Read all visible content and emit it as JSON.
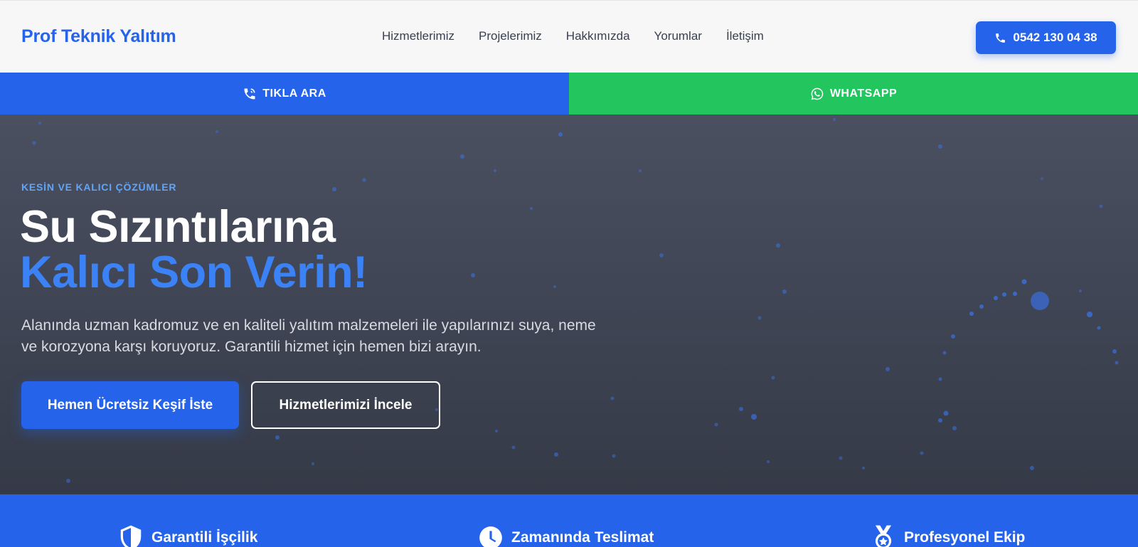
{
  "header": {
    "brand": "Prof Teknik Yalıtım",
    "nav": [
      "Hizmetlerimiz",
      "Projelerimiz",
      "Hakkımızda",
      "Yorumlar",
      "İletişim"
    ],
    "phone": "0542 130 04 38",
    "phone_icon": "phone-icon"
  },
  "callbar": {
    "call_label": "TIKLA ARA",
    "call_icon": "phone-call-icon",
    "whatsapp_label": "WHATSAPP",
    "whatsapp_icon": "whatsapp-icon"
  },
  "hero": {
    "eyebrow": "KESİN VE KALICI ÇÖZÜMLER",
    "title_line1": "Su Sızıntılarına",
    "title_line2": "Kalıcı Son Verin!",
    "lead": "Alanında uzman kadromuz ve en kaliteli yalıtım malzemeleri ile yapılarınızı suya, neme ve korozyona karşı koruyoruz. Garantili hizmet için hemen bizi arayın.",
    "primary_button": "Hemen Ücretsiz Keşif İste",
    "secondary_button": "Hizmetlerimizi İncele"
  },
  "features": [
    {
      "label": "Garantili İşçilik",
      "icon": "shield-icon"
    },
    {
      "label": "Zamanında Teslimat",
      "icon": "clock-icon"
    },
    {
      "label": "Profesyonel Ekip",
      "icon": "medal-icon"
    }
  ],
  "colors": {
    "primary": "#2563eb",
    "whatsapp": "#22c55e",
    "accent_text": "#3b82f6",
    "hero_bg": "#404655"
  }
}
